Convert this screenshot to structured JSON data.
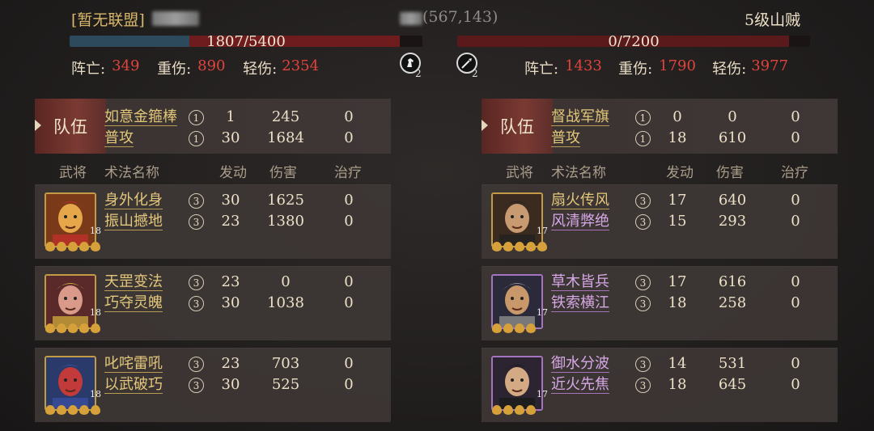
{
  "header": {
    "left_alliance": "[暂无联盟]",
    "left_hp": "1807/5400",
    "left_hp_fraction": 0.335,
    "center_coords": "(567,143)",
    "right_name": "5级山贼",
    "right_hp": "0/7200",
    "right_hp_fraction": 0.0,
    "left_stats": {
      "dead_label": "阵亡:",
      "dead": "349",
      "heavy_label": "重伤:",
      "heavy": "890",
      "light_label": "轻伤:",
      "light": "2354"
    },
    "right_stats": {
      "dead_label": "阵亡:",
      "dead": "1433",
      "heavy_label": "重伤:",
      "heavy": "1790",
      "light_label": "轻伤:",
      "light": "3977"
    },
    "left_icon": "horse-icon",
    "left_icon_count": "2",
    "right_icon": "spear-icon",
    "right_icon_count": "2"
  },
  "columns": {
    "general": "武将",
    "skill": "术法名称",
    "trigger": "发动",
    "damage": "伤害",
    "heal": "治疗"
  },
  "left": {
    "team_label": "队伍",
    "team_skills": [
      {
        "name": "如意金箍棒",
        "rank": "①",
        "trigger": "1",
        "damage": "245",
        "heal": "0"
      },
      {
        "name": "普攻",
        "rank": "①",
        "trigger": "30",
        "damage": "1684",
        "heal": "0"
      }
    ],
    "generals": [
      {
        "level": "18",
        "stars": 5,
        "skills": [
          {
            "name": "身外化身",
            "rank": "③",
            "trigger": "30",
            "damage": "1625",
            "heal": "0"
          },
          {
            "name": "振山撼地",
            "rank": "③",
            "trigger": "23",
            "damage": "1380",
            "heal": "0"
          }
        ]
      },
      {
        "level": "18",
        "stars": 5,
        "skills": [
          {
            "name": "天罡变法",
            "rank": "③",
            "trigger": "23",
            "damage": "0",
            "heal": "0"
          },
          {
            "name": "巧夺灵魄",
            "rank": "③",
            "trigger": "30",
            "damage": "1038",
            "heal": "0"
          }
        ]
      },
      {
        "level": "18",
        "stars": 5,
        "skills": [
          {
            "name": "叱咤雷吼",
            "rank": "③",
            "trigger": "23",
            "damage": "703",
            "heal": "0"
          },
          {
            "name": "以武破巧",
            "rank": "③",
            "trigger": "30",
            "damage": "525",
            "heal": "0"
          }
        ]
      }
    ]
  },
  "right": {
    "team_label": "队伍",
    "team_skills": [
      {
        "name": "督战军旗",
        "rank": "①",
        "trigger": "0",
        "damage": "0",
        "heal": "0"
      },
      {
        "name": "普攻",
        "rank": "①",
        "trigger": "18",
        "damage": "610",
        "heal": "0"
      }
    ],
    "generals": [
      {
        "level": "17",
        "stars": 5,
        "skills": [
          {
            "name": "扇火传风",
            "rank": "③",
            "trigger": "17",
            "damage": "640",
            "heal": "0"
          },
          {
            "name": "风清弊绝",
            "rank": "③",
            "trigger": "15",
            "damage": "293",
            "heal": "0"
          }
        ]
      },
      {
        "level": "17",
        "stars": 4,
        "skills": [
          {
            "name": "草木皆兵",
            "rank": "③",
            "trigger": "17",
            "damage": "616",
            "heal": "0"
          },
          {
            "name": "铁索横江",
            "rank": "③",
            "trigger": "18",
            "damage": "258",
            "heal": "0"
          }
        ]
      },
      {
        "level": "17",
        "stars": 4,
        "skills": [
          {
            "name": "御水分波",
            "rank": "③",
            "trigger": "14",
            "damage": "531",
            "heal": "0"
          },
          {
            "name": "近火先焦",
            "rank": "③",
            "trigger": "18",
            "damage": "645",
            "heal": "0"
          }
        ]
      }
    ]
  }
}
